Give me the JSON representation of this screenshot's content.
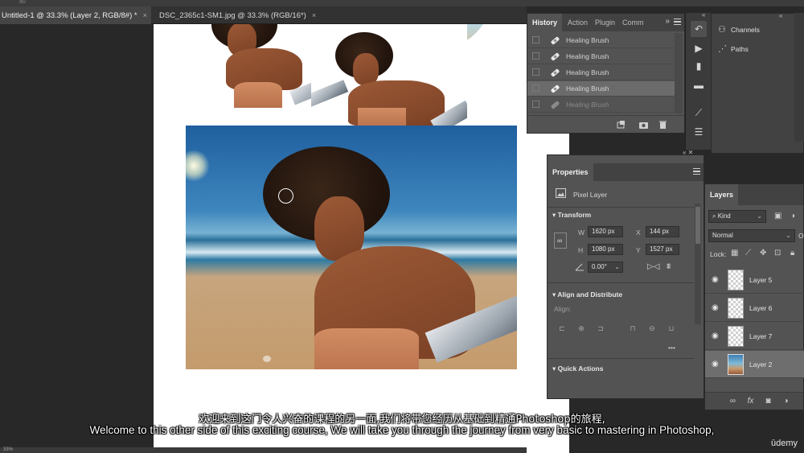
{
  "app": {
    "top_label": "80",
    "doc_tabs": [
      {
        "label": "Untitled-1 @ 33.3% (Layer 2, RGB/8#) *",
        "close": "×"
      },
      {
        "label": "DSC_2365c1-SM1.jpg @ 33.3% (RGB/16*)",
        "close": "×"
      }
    ],
    "status": "33%"
  },
  "history": {
    "tabs": [
      "History",
      "Action",
      "Plugin",
      "Comm"
    ],
    "chevron": "»",
    "items": [
      "Healing Brush",
      "Healing Brush",
      "Healing Brush",
      "Healing Brush",
      "Healing Brush"
    ]
  },
  "channels": {
    "items": [
      {
        "label": "Channels",
        "icon": "channels-icon"
      },
      {
        "label": "Paths",
        "icon": "paths-icon"
      }
    ]
  },
  "properties": {
    "tab": "Properties",
    "layer_type": "Pixel Layer",
    "transform_heading": "Transform",
    "w_label": "W",
    "w_value": "1620 px",
    "x_label": "X",
    "x_value": "144 px",
    "h_label": "H",
    "h_value": "1080 px",
    "y_label": "Y",
    "y_value": "1527 px",
    "angle_value": "0.00°",
    "align_heading": "Align and Distribute",
    "align_label": "Align:",
    "more": "•••",
    "quick_heading": "Quick Actions"
  },
  "layers": {
    "tab": "Layers",
    "kind_label": "Kind",
    "blend_mode": "Normal",
    "opacity_label": "O",
    "lock_label": "Lock:",
    "rows": [
      {
        "name": "Layer 5",
        "type": "checker",
        "selected": false
      },
      {
        "name": "Layer 6",
        "type": "checker",
        "selected": false
      },
      {
        "name": "Layer 7",
        "type": "checker",
        "selected": false
      },
      {
        "name": "Layer 2",
        "type": "photo",
        "selected": true
      }
    ],
    "fx_label": "fx"
  },
  "subtitles": {
    "chinese": "欢迎来到这门令人兴奋的课程的另一面,我们将带您经历从基础到精通Photoshop的旅程,",
    "english": "Welcome to this other side of this exciting course, We will take you through the journey from very basic to mastering in Photoshop,"
  },
  "watermark": "ūdemy"
}
